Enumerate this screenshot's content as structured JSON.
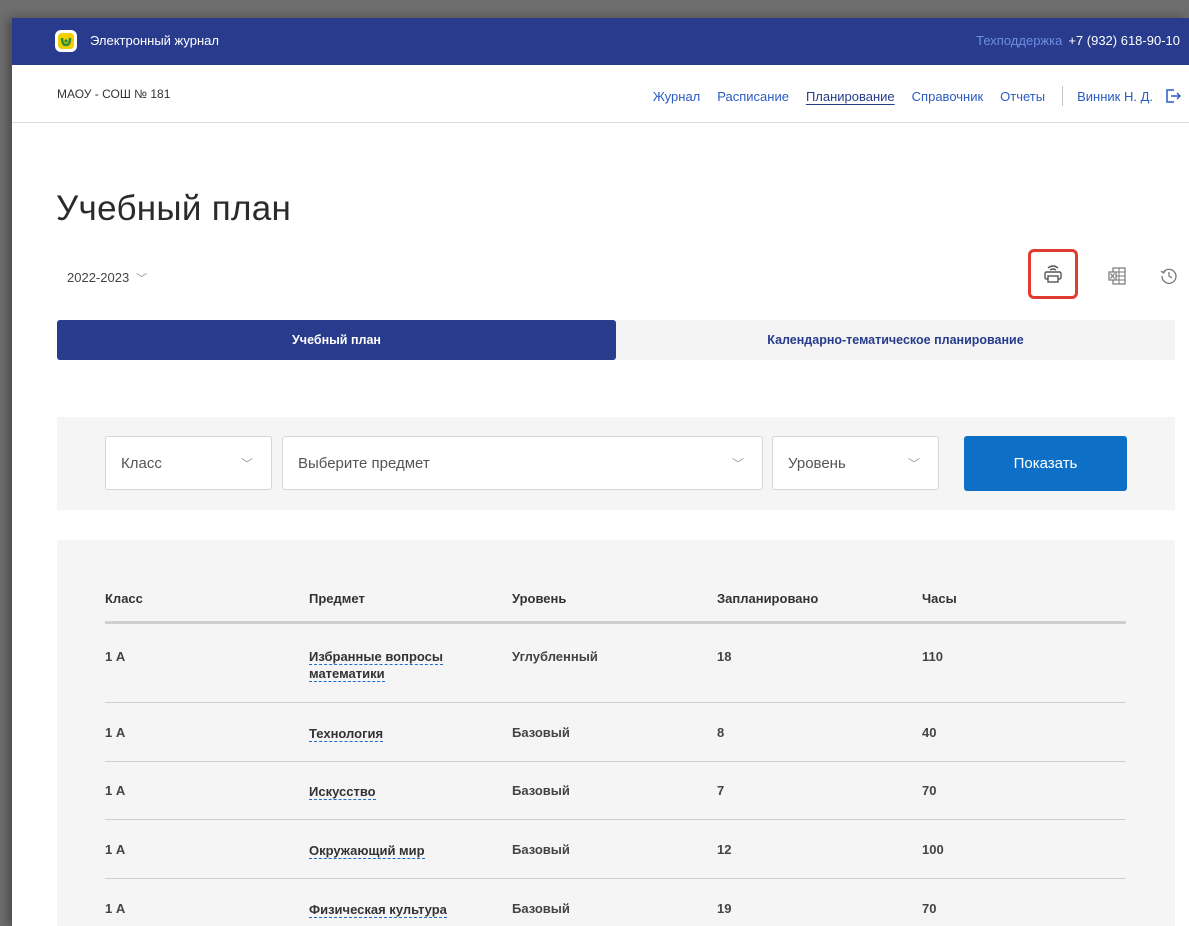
{
  "header": {
    "app_title": "Электронный журнал",
    "support_label": "Техподдержка",
    "support_phone": "+7 (932) 618-90-10",
    "logo_icon": "app-logo-icon"
  },
  "nav": {
    "school": "МАОУ - СОШ № 181",
    "items": [
      {
        "label": "Журнал"
      },
      {
        "label": "Расписание"
      },
      {
        "label": "Планирование"
      },
      {
        "label": "Справочник"
      },
      {
        "label": "Отчеты"
      }
    ],
    "active_item": "Планирование",
    "user": "Винник Н. Д.",
    "logout_icon": "logout-icon"
  },
  "page": {
    "title": "Учебный план",
    "year": "2022-2023",
    "tools": [
      "print-icon",
      "excel-icon",
      "history-icon"
    ],
    "highlight_color": "#e03b2f"
  },
  "tabs": [
    {
      "label": "Учебный план",
      "active": true
    },
    {
      "label": "Календарно-тематическое планирование",
      "active": false
    }
  ],
  "filters": {
    "class_placeholder": "Класс",
    "subject_placeholder": "Выберите предмет",
    "level_placeholder": "Уровень",
    "show_button": "Показать"
  },
  "table": {
    "columns": [
      "Класс",
      "Предмет",
      "Уровень",
      "Запланировано",
      "Часы"
    ],
    "rows": [
      {
        "class": "1 А",
        "subject_line1": "Избранные вопросы",
        "subject_line2": "математики",
        "level": "Углубленный",
        "planned": "18",
        "hours": "110"
      },
      {
        "class": "1 А",
        "subject": "Технология",
        "level": "Базовый",
        "planned": "8",
        "hours": "40"
      },
      {
        "class": "1 А",
        "subject": "Искусство",
        "level": "Базовый",
        "planned": "7",
        "hours": "70"
      },
      {
        "class": "1 А",
        "subject": "Окружающий мир",
        "level": "Базовый",
        "planned": "12",
        "hours": "100"
      },
      {
        "class": "1 А",
        "subject": "Физическая культура",
        "level": "Базовый",
        "planned": "19",
        "hours": "70"
      }
    ]
  },
  "colors": {
    "primary": "#283b8c",
    "button": "#0e6fc7",
    "link": "#2a5cc4"
  }
}
